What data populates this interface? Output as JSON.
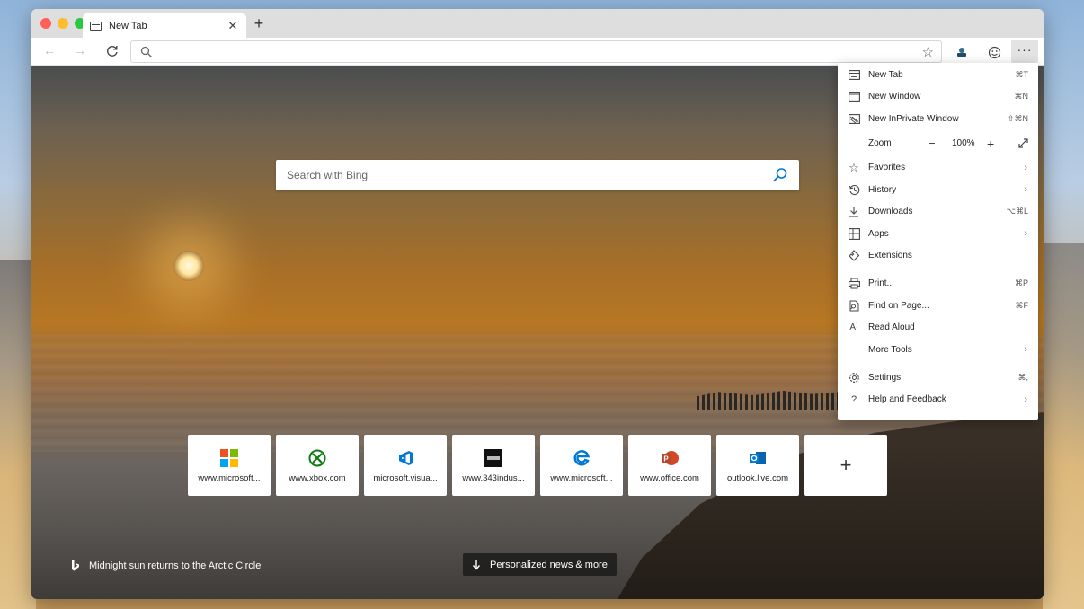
{
  "browser": {
    "tab": {
      "title": "New Tab"
    },
    "address_bar": {
      "value": "",
      "placeholder": ""
    }
  },
  "new_tab_page": {
    "search": {
      "placeholder": "Search with Bing"
    },
    "tiles": [
      {
        "label": "www.microsoft...",
        "logo": "microsoft-logo"
      },
      {
        "label": "www.xbox.com",
        "logo": "xbox-logo"
      },
      {
        "label": "microsoft.visua...",
        "logo": "visual-studio-logo"
      },
      {
        "label": "www.343indus...",
        "logo": "343-industries-logo"
      },
      {
        "label": "www.microsoft...",
        "logo": "edge-logo"
      },
      {
        "label": "www.office.com",
        "logo": "powerpoint-logo"
      },
      {
        "label": "outlook.live.com",
        "logo": "outlook-logo"
      }
    ],
    "caption": "Midnight sun returns to the Arctic Circle",
    "news_button": "Personalized news & more"
  },
  "menu": {
    "items": [
      {
        "label": "New Tab",
        "shortcut": "⌘T",
        "icon": "new-tab-icon"
      },
      {
        "label": "New Window",
        "shortcut": "⌘N",
        "icon": "new-window-icon"
      },
      {
        "label": "New InPrivate Window",
        "shortcut": "⇧⌘N",
        "icon": "inprivate-icon"
      },
      {
        "label": "Favorites",
        "shortcut": "",
        "icon": "star-icon"
      },
      {
        "label": "History",
        "shortcut": "",
        "icon": "history-icon"
      },
      {
        "label": "Downloads",
        "shortcut": "⌥⌘L",
        "icon": "download-icon"
      },
      {
        "label": "Apps",
        "shortcut": "",
        "icon": "apps-icon"
      },
      {
        "label": "Extensions",
        "shortcut": "",
        "icon": "extensions-icon"
      },
      {
        "label": "Print...",
        "shortcut": "⌘P",
        "icon": "print-icon"
      },
      {
        "label": "Find on Page...",
        "shortcut": "⌘F",
        "icon": "find-icon"
      },
      {
        "label": "Read Aloud",
        "shortcut": "",
        "icon": "read-aloud-icon"
      },
      {
        "label": "More Tools",
        "shortcut": "",
        "icon": "more-tools"
      },
      {
        "label": "Settings",
        "shortcut": "⌘,",
        "icon": "gear-icon"
      },
      {
        "label": "Help and Feedback",
        "shortcut": "",
        "icon": "help-icon"
      }
    ],
    "zoom": {
      "label": "Zoom",
      "value": "100%",
      "minus": "−",
      "plus": "+"
    }
  },
  "colors": {
    "accent": "#0078d4",
    "menu_bg": "#ffffff",
    "titlebar": "#dedede"
  }
}
